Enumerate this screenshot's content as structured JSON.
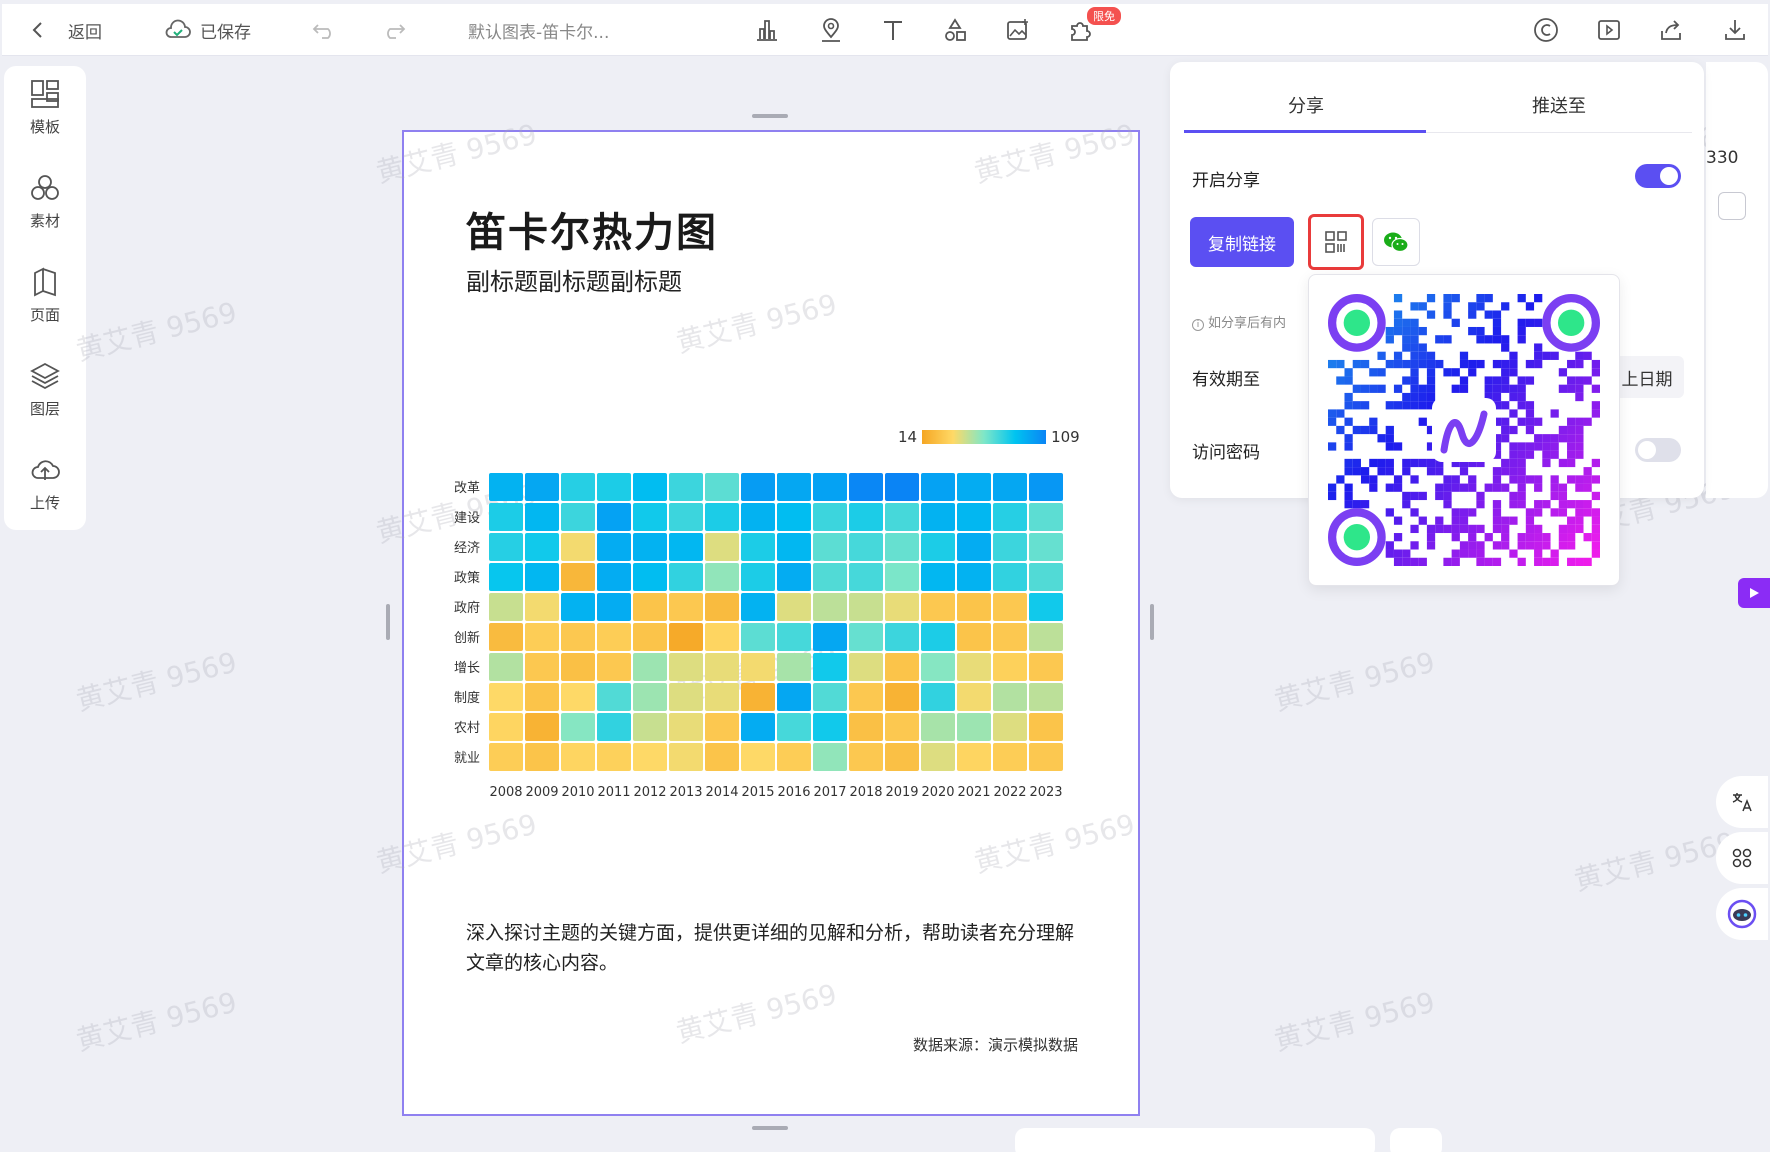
{
  "toolbar": {
    "back_label": "返回",
    "saved_label": "已保存",
    "doc_title": "默认图表-笛卡尔...",
    "badge": "限免"
  },
  "sidebar": {
    "items": [
      {
        "label": "模板",
        "icon": "template-icon"
      },
      {
        "label": "素材",
        "icon": "assets-icon"
      },
      {
        "label": "页面",
        "icon": "page-icon"
      },
      {
        "label": "图层",
        "icon": "layers-icon"
      },
      {
        "label": "上传",
        "icon": "upload-icon"
      }
    ]
  },
  "canvas": {
    "title": "笛卡尔热力图",
    "subtitle": "副标题副标题副标题",
    "description": "深入探讨主题的关键方面，提供更详细的见解和分析，帮助读者充分理解文章的核心内容。",
    "source": "数据来源：演示模拟数据",
    "watermark": "黄艾青 9569"
  },
  "chart_data": {
    "type": "heatmap",
    "x": [
      "2008",
      "2009",
      "2010",
      "2011",
      "2012",
      "2013",
      "2014",
      "2015",
      "2016",
      "2017",
      "2018",
      "2019",
      "2020",
      "2021",
      "2022",
      "2023"
    ],
    "y": [
      "改革",
      "建设",
      "经济",
      "政策",
      "政府",
      "创新",
      "增长",
      "制度",
      "农村",
      "就业"
    ],
    "range": [
      14,
      109
    ],
    "legend_min": "14",
    "legend_max": "109",
    "colors": [
      "#f5a623",
      "#ffd966",
      "#7ee7c8",
      "#00c4f0",
      "#0a84f5"
    ],
    "values": [
      [
        92,
        96,
        78,
        80,
        88,
        74,
        68,
        100,
        96,
        98,
        108,
        109,
        98,
        94,
        96,
        102
      ],
      [
        80,
        90,
        74,
        98,
        82,
        74,
        80,
        92,
        88,
        74,
        80,
        72,
        92,
        90,
        78,
        68
      ],
      [
        78,
        82,
        40,
        94,
        92,
        90,
        44,
        80,
        90,
        68,
        72,
        66,
        80,
        94,
        74,
        66
      ],
      [
        84,
        90,
        22,
        94,
        88,
        76,
        58,
        80,
        94,
        70,
        72,
        62,
        90,
        92,
        76,
        70
      ],
      [
        48,
        40,
        92,
        94,
        28,
        30,
        24,
        92,
        44,
        50,
        48,
        42,
        30,
        28,
        30,
        82
      ],
      [
        24,
        32,
        30,
        32,
        28,
        16,
        36,
        68,
        72,
        96,
        66,
        74,
        80,
        28,
        30,
        50
      ],
      [
        52,
        30,
        26,
        30,
        56,
        44,
        42,
        40,
        54,
        82,
        44,
        28,
        60,
        42,
        34,
        30
      ],
      [
        38,
        28,
        38,
        70,
        56,
        44,
        42,
        20,
        96,
        70,
        30,
        20,
        76,
        40,
        52,
        50
      ],
      [
        36,
        20,
        60,
        76,
        48,
        42,
        30,
        94,
        72,
        82,
        26,
        30,
        54,
        56,
        44,
        28
      ],
      [
        32,
        28,
        36,
        34,
        38,
        40,
        28,
        38,
        32,
        58,
        30,
        26,
        44,
        36,
        32,
        30
      ]
    ]
  },
  "share": {
    "tab_share": "分享",
    "tab_push": "推送至",
    "enable_label": "开启分享",
    "enable_on": true,
    "copy_link": "复制链接",
    "hint": "如分享后有内",
    "expire_label": "有效期至",
    "expire_value": "上日期",
    "password_label": "访问密码",
    "password_on": false,
    "right_value": "330"
  }
}
